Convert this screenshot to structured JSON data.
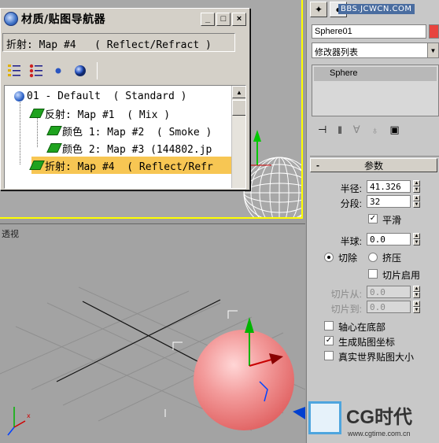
{
  "watermark_top": "BBS.JCWCN.COM",
  "material_navigator": {
    "title": "材质/贴图导航器",
    "window_buttons": {
      "minimize": "_",
      "maximize": "□",
      "close": "×"
    },
    "current_field": "折射: Map #4   ( Reflect/Refract )",
    "tree": [
      {
        "label": "01 - Default  ( Standard )",
        "icon": "material-sphere-icon",
        "selected": false
      },
      {
        "label": "反射: Map #1  ( Mix )",
        "icon": "map-icon",
        "selected": false
      },
      {
        "label": "颜色 1: Map #2  ( Smoke )",
        "icon": "map-icon",
        "selected": false
      },
      {
        "label": "颜色 2: Map #3 (144802.jp",
        "icon": "map-icon",
        "selected": false
      },
      {
        "label": "折射: Map #4  ( Reflect/Refr",
        "icon": "map-icon",
        "selected": true
      }
    ]
  },
  "viewport": {
    "persp_label": "透视"
  },
  "command_panel": {
    "object_name": "Sphere01",
    "object_color": "#e8443f",
    "modifier_list": "修改器列表",
    "stack_item": "Sphere",
    "params": {
      "title": "参数",
      "collapse": "-",
      "radius_label": "半径:",
      "radius_value": "41.326",
      "segments_label": "分段:",
      "segments_value": "32",
      "smooth_label": "平滑",
      "smooth_checked": true,
      "hemisphere_label": "半球:",
      "hemisphere_value": "0.0",
      "chop_label": "切除",
      "squash_label": "挤压",
      "slice_on_label": "切片启用",
      "slice_from_label": "切片从:",
      "slice_from_value": "0.0",
      "slice_to_label": "切片到:",
      "slice_to_value": "0.0",
      "base_to_pivot_label": "轴心在底部",
      "gen_map_coords_label": "生成贴图坐标",
      "real_world_label": "真实世界贴图大小"
    }
  },
  "logo": {
    "text": "CG时代",
    "url": "www.cgtime.com.cn"
  }
}
